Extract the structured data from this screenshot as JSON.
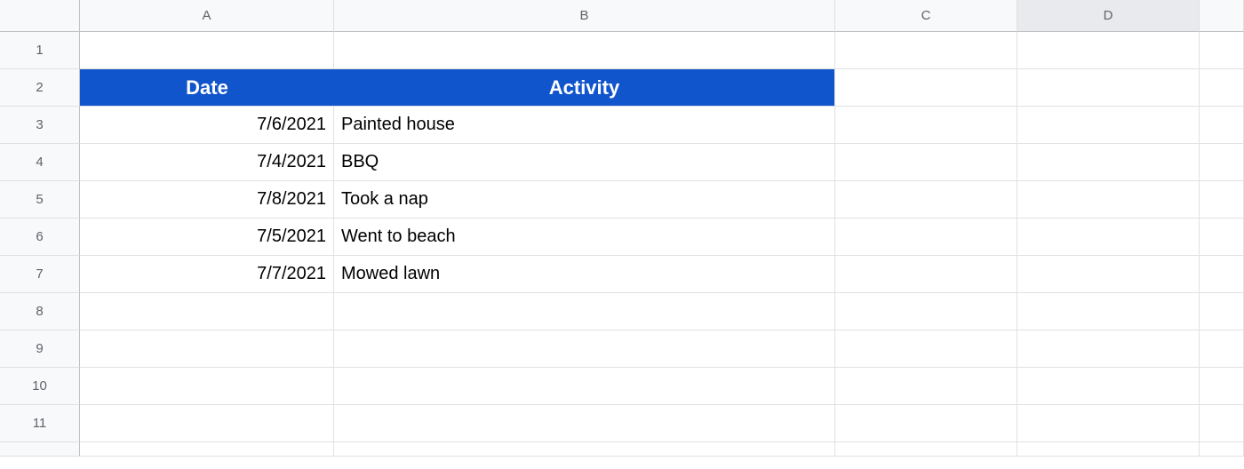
{
  "columns": {
    "a": "A",
    "b": "B",
    "c": "C",
    "d": "D"
  },
  "rows": {
    "r1": "1",
    "r2": "2",
    "r3": "3",
    "r4": "4",
    "r5": "5",
    "r6": "6",
    "r7": "7",
    "r8": "8",
    "r9": "9",
    "r10": "10",
    "r11": "11"
  },
  "headers": {
    "date": "Date",
    "activity": "Activity"
  },
  "data": {
    "r3": {
      "date": "7/6/2021",
      "activity": "Painted house"
    },
    "r4": {
      "date": "7/4/2021",
      "activity": "BBQ"
    },
    "r5": {
      "date": "7/8/2021",
      "activity": "Took a nap"
    },
    "r6": {
      "date": "7/5/2021",
      "activity": "Went to beach"
    },
    "r7": {
      "date": "7/7/2021",
      "activity": "Mowed lawn"
    }
  }
}
